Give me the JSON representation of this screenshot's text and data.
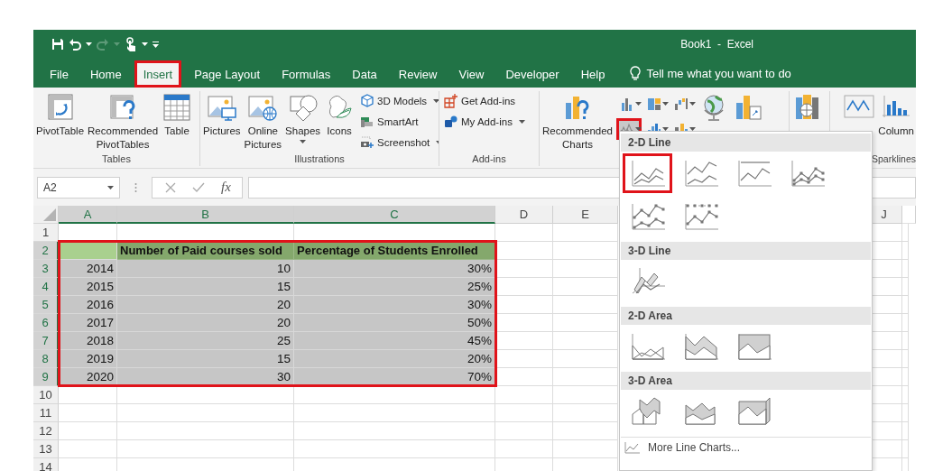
{
  "window": {
    "title": "Book1  -  Excel"
  },
  "tabs": [
    {
      "label": "File",
      "selected": false,
      "highlighted": false
    },
    {
      "label": "Home",
      "selected": false,
      "highlighted": false
    },
    {
      "label": "Insert",
      "selected": true,
      "highlighted": true
    },
    {
      "label": "Page Layout",
      "selected": false,
      "highlighted": false
    },
    {
      "label": "Formulas",
      "selected": false,
      "highlighted": false
    },
    {
      "label": "Data",
      "selected": false,
      "highlighted": false
    },
    {
      "label": "Review",
      "selected": false,
      "highlighted": false
    },
    {
      "label": "View",
      "selected": false,
      "highlighted": false
    },
    {
      "label": "Developer",
      "selected": false,
      "highlighted": false
    },
    {
      "label": "Help",
      "selected": false,
      "highlighted": false
    }
  ],
  "tell_me": {
    "label": "Tell me what you want to do"
  },
  "ribbon": {
    "groups": [
      {
        "kind": "tables",
        "label": "Tables",
        "items": [
          {
            "kind": "pivot-table",
            "label": "PivotTable"
          },
          {
            "kind": "recommended-pivot",
            "label": "Recommended PivotTables"
          },
          {
            "kind": "table",
            "label": "Table"
          }
        ]
      },
      {
        "kind": "illustrations",
        "label": "Illustrations",
        "items": [
          {
            "kind": "pictures",
            "label": "Pictures"
          },
          {
            "kind": "online-pictures",
            "label": "Online Pictures"
          },
          {
            "kind": "shapes",
            "label": "Shapes",
            "dropdown": true
          },
          {
            "kind": "icons",
            "label": "Icons"
          },
          {
            "kind": "models",
            "label": "3D Models",
            "dropdown": true
          },
          {
            "kind": "smartart",
            "label": "SmartArt"
          },
          {
            "kind": "screenshot",
            "label": "Screenshot",
            "dropdown": true
          }
        ]
      },
      {
        "kind": "addins",
        "label": "Add-ins",
        "items": [
          {
            "kind": "get-addins",
            "label": "Get Add-ins"
          },
          {
            "kind": "my-addins",
            "label": "My Add-ins",
            "dropdown": true
          }
        ]
      },
      {
        "kind": "charts",
        "items": [
          {
            "kind": "recommended-charts",
            "label": "Recommended Charts"
          },
          {
            "kind": "chart-types",
            "buttons": [
              {
                "kind": "column",
                "highlighted": false
              },
              {
                "kind": "hierarchy",
                "highlighted": false
              },
              {
                "kind": "waterfall",
                "highlighted": false
              },
              {
                "kind": "line",
                "highlighted": true
              },
              {
                "kind": "bar-stats",
                "highlighted": false
              },
              {
                "kind": "combo",
                "highlighted": false
              }
            ]
          },
          {
            "kind": "maps"
          },
          {
            "kind": "pivot-chart"
          }
        ]
      },
      {
        "kind": "tours",
        "items": [
          {
            "kind": "tourmap"
          }
        ]
      },
      {
        "kind": "sparklines",
        "label": "Sparklines",
        "items": [
          {
            "kind": "spark-line"
          },
          {
            "kind": "spark-column",
            "label": "Column"
          }
        ]
      }
    ]
  },
  "formula_bar": {
    "name_box": "A2",
    "function_label": "fx"
  },
  "sheet": {
    "range_highlighted": true,
    "columns": [
      {
        "label": "A",
        "selected": true
      },
      {
        "label": "B",
        "selected": true
      },
      {
        "label": "C",
        "selected": true
      },
      {
        "label": "D",
        "selected": false
      },
      {
        "label": "E",
        "selected": false
      },
      {
        "label": "J",
        "selected": false
      }
    ],
    "rows": [
      {
        "number": "1",
        "kind": "empty",
        "selected": false
      },
      {
        "number": "2",
        "kind": "header",
        "selected": true,
        "cells": [
          "Number of Paid courses sold",
          "Percentage of Students Enrolled"
        ]
      },
      {
        "number": "3",
        "kind": "data",
        "selected": true,
        "cells": [
          "2014",
          "10",
          "30%"
        ]
      },
      {
        "number": "4",
        "kind": "data",
        "selected": true,
        "cells": [
          "2015",
          "15",
          "25%"
        ]
      },
      {
        "number": "5",
        "kind": "data",
        "selected": true,
        "cells": [
          "2016",
          "20",
          "30%"
        ]
      },
      {
        "number": "6",
        "kind": "data",
        "selected": true,
        "cells": [
          "2017",
          "20",
          "50%"
        ]
      },
      {
        "number": "7",
        "kind": "data",
        "selected": true,
        "cells": [
          "2018",
          "25",
          "45%"
        ]
      },
      {
        "number": "8",
        "kind": "data",
        "selected": true,
        "cells": [
          "2019",
          "15",
          "20%"
        ]
      },
      {
        "number": "9",
        "kind": "data",
        "selected": true,
        "cells": [
          "2020",
          "30",
          "70%"
        ]
      },
      {
        "number": "10",
        "kind": "empty",
        "selected": false
      },
      {
        "number": "11",
        "kind": "empty",
        "selected": false
      },
      {
        "number": "12",
        "kind": "empty",
        "selected": false
      },
      {
        "number": "13",
        "kind": "empty",
        "selected": false
      },
      {
        "number": "14",
        "kind": "empty",
        "selected": false
      }
    ]
  },
  "gallery": {
    "sections": [
      {
        "title": "2-D Line",
        "items": [
          {
            "kind": "line",
            "highlighted": true
          },
          {
            "kind": "stacked-line",
            "highlighted": false
          },
          {
            "kind": "line-100",
            "highlighted": false
          },
          {
            "kind": "line-markers",
            "highlighted": false
          },
          {
            "kind": "stacked-line-markers",
            "highlighted": false
          },
          {
            "kind": "line-100-markers",
            "highlighted": false
          }
        ]
      },
      {
        "title": "3-D Line",
        "items": [
          {
            "kind": "line-3d",
            "highlighted": false
          }
        ]
      },
      {
        "title": "2-D Area",
        "items": [
          {
            "kind": "area",
            "highlighted": false
          },
          {
            "kind": "stacked-area",
            "highlighted": false
          },
          {
            "kind": "area-100",
            "highlighted": false
          }
        ]
      },
      {
        "title": "3-D Area",
        "items": [
          {
            "kind": "area-3d",
            "highlighted": false
          },
          {
            "kind": "stacked-area-3d",
            "highlighted": false
          },
          {
            "kind": "area-100-3d",
            "highlighted": false
          }
        ]
      }
    ],
    "footer": "More Line Charts..."
  }
}
